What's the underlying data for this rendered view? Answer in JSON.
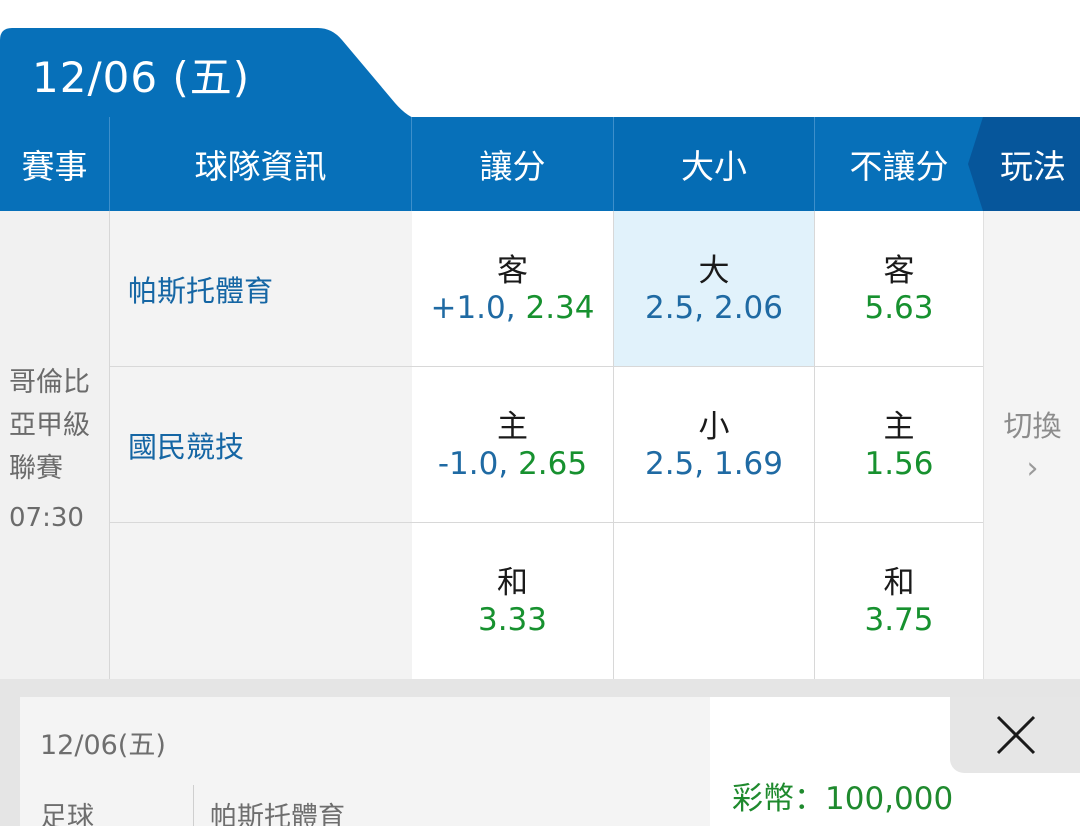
{
  "date_tab": {
    "label": "12/06 (五)"
  },
  "header": {
    "event": "賽事",
    "team_info": "球隊資訊",
    "handicap": "讓分",
    "over_under": "大小",
    "moneyline": "不讓分",
    "play": "玩法"
  },
  "match": {
    "league": "哥倫比亞甲級聯賽",
    "time": "07:30",
    "away_team": "帕斯托體育",
    "home_team": "國民競技"
  },
  "odds": {
    "handicap": {
      "away": {
        "label": "客",
        "line": "+1.0,",
        "price": "2.34"
      },
      "home": {
        "label": "主",
        "line": "-1.0,",
        "price": "2.65"
      },
      "draw": {
        "label": "和",
        "price": "3.33"
      }
    },
    "over_under": {
      "over": {
        "label": "大",
        "line": "2.5,",
        "price": "2.06"
      },
      "under": {
        "label": "小",
        "line": "2.5,",
        "price": "1.69"
      }
    },
    "moneyline": {
      "away": {
        "label": "客",
        "price": "5.63"
      },
      "home": {
        "label": "主",
        "price": "1.56"
      },
      "draw": {
        "label": "和",
        "price": "3.75"
      }
    }
  },
  "switch": {
    "label": "切換",
    "chevron": "›"
  },
  "bet_slip": {
    "date": "12/06(五)",
    "sport": "足球",
    "team": "帕斯托體育",
    "coins": "彩幣：100,000"
  },
  "colors": {
    "header_blue": "#0770b9",
    "selected_cell": "#e1f2fb",
    "odds_green": "#17912f",
    "line_blue": "#1f6aa3"
  },
  "icons": {
    "close": "close-icon",
    "chevron": "chevron-right-icon"
  }
}
